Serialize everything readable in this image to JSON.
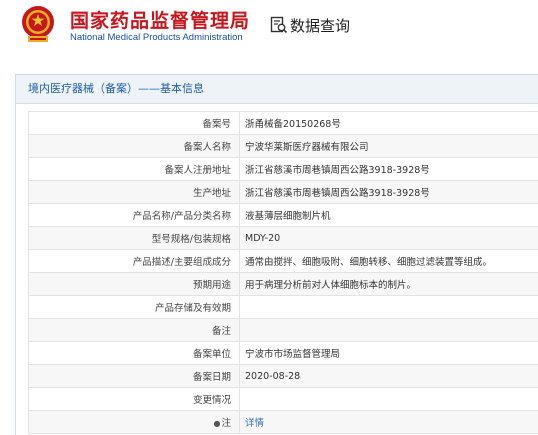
{
  "header": {
    "org_name_cn": "国家药品监督管理局",
    "org_name_en": "National Medical Products Administration",
    "query_label": "数据查询"
  },
  "panel": {
    "title": "境内医疗器械（备案）——基本信息"
  },
  "rows": [
    {
      "label": "备案号",
      "value": "浙甬械备20150268号"
    },
    {
      "label": "备案人名称",
      "value": "宁波华莱斯医疗器械有限公司"
    },
    {
      "label": "备案人注册地址",
      "value": "浙江省慈溪市周巷镇周西公路3918-3928号"
    },
    {
      "label": "生产地址",
      "value": "浙江省慈溪市周巷镇周西公路3918-3928号"
    },
    {
      "label": "产品名称/产品分类名称",
      "value": "液基薄层细胞制片机"
    },
    {
      "label": "型号规格/包装规格",
      "value": "MDY-20"
    },
    {
      "label": "产品描述/主要组成成分",
      "value": "通常由搅拌、细胞吸附、细胞转移、细胞过滤装置等组成。"
    },
    {
      "label": "预期用途",
      "value": "用于病理分析前对人体细胞标本的制片。"
    },
    {
      "label": "产品存储及有效期",
      "value": ""
    },
    {
      "label": "备注",
      "value": ""
    },
    {
      "label": "备案单位",
      "value": "宁波市市场监督管理局"
    },
    {
      "label": "备案日期",
      "value": "2020-08-28"
    },
    {
      "label": "变更情况",
      "value": ""
    },
    {
      "label": "注",
      "value": "详情"
    }
  ],
  "colors": {
    "brand_red": "#c8161d",
    "brand_blue": "#1a4fa0",
    "link_blue": "#3070c0"
  },
  "icons": {
    "emblem": "national-emblem-icon",
    "query": "search-document-icon",
    "tip": "tip-icon"
  }
}
